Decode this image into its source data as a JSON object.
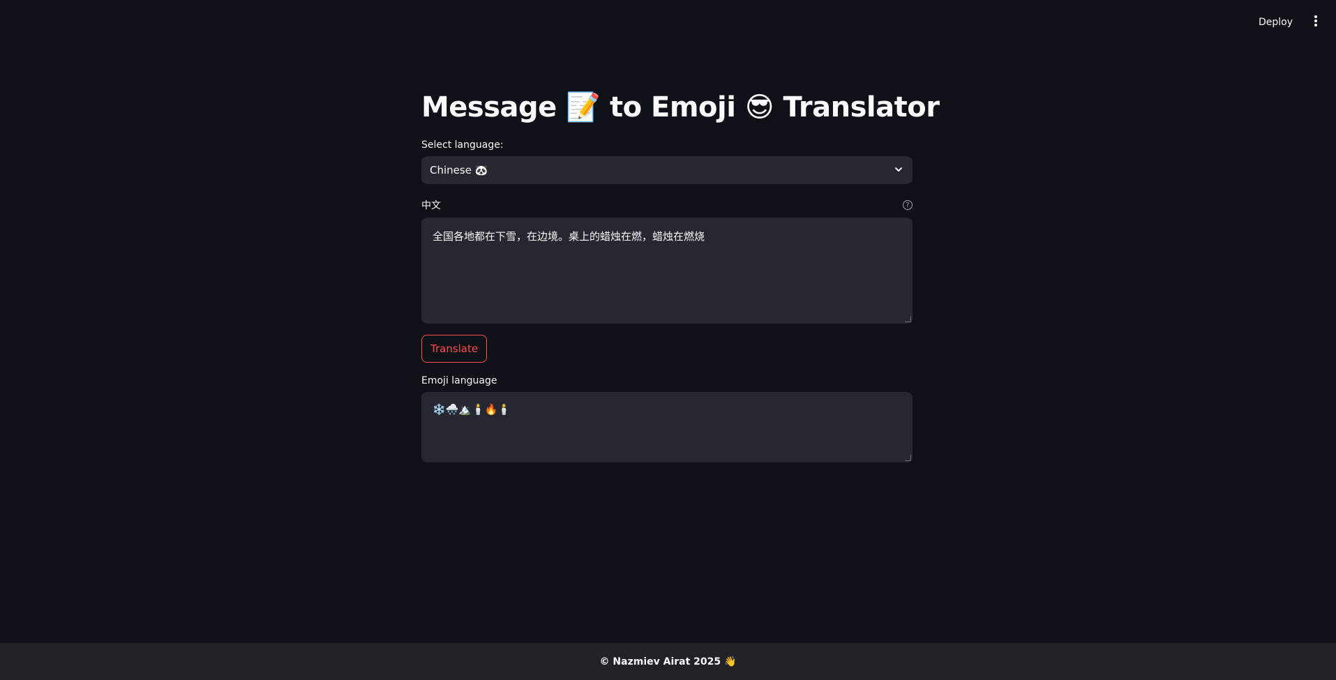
{
  "header": {
    "deploy_label": "Deploy",
    "menu_icon": "kebab-menu-icon"
  },
  "main": {
    "title_part1": "Message",
    "title_emoji1": "📝",
    "title_part2": "to Emoji",
    "title_emoji2": "😎",
    "title_part3": "Translator",
    "language_label": "Select language:",
    "language_value": "Chinese 🐼",
    "input_label": "中文",
    "input_value": "全国各地都在下雪，在边境。桌上的蜡烛在燃，蜡烛在燃烧",
    "translate_label": "Translate",
    "output_label": "Emoji language",
    "output_value": "❄️🌨️🏔️🕯️🔥🕯️"
  },
  "footer": {
    "text": "© Nazmiev Airat 2025 👋"
  },
  "colors": {
    "background": "#0e1117",
    "field": "#262730",
    "accent": "#ff4b4b",
    "footer": "#1f2226"
  }
}
